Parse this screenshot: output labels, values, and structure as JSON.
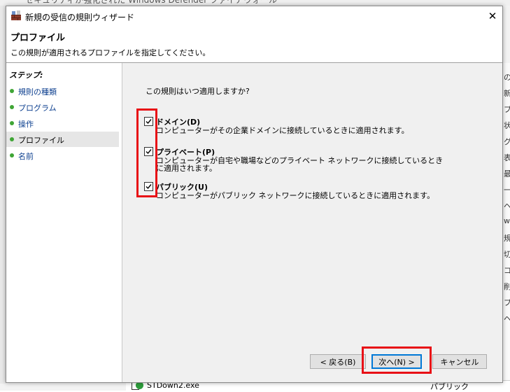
{
  "background_window": {
    "title": "セキュリティが強化された Windows Defender ファイアウォール",
    "right_panel_items": [
      "の",
      "新",
      "プ",
      "状",
      "グ",
      "表",
      "最",
      "一",
      "ヘ",
      "w",
      "規",
      "切",
      "コ",
      "削",
      "プ",
      "ヘ"
    ],
    "table_row": {
      "name": "STDown2.exe",
      "profile": "パブリック"
    }
  },
  "wizard": {
    "title": "新規の受信の規則ウィザード",
    "close_glyph": "✕",
    "header": {
      "title": "プロファイル",
      "subtitle": "この規則が適用されるプロファイルを指定してください。"
    },
    "steps_label": "ステップ:",
    "steps": [
      {
        "label": "規則の種類",
        "active": false
      },
      {
        "label": "プログラム",
        "active": false
      },
      {
        "label": "操作",
        "active": false
      },
      {
        "label": "プロファイル",
        "active": true
      },
      {
        "label": "名前",
        "active": false
      }
    ],
    "question": "この規則はいつ適用しますか?",
    "options": [
      {
        "label": "ドメイン(D)",
        "description": "コンピューターがその企業ドメインに接続しているときに適用されます。",
        "checked": true
      },
      {
        "label": "プライベート(P)",
        "description": "コンピューターが自宅や職場などのプライベート ネットワークに接続しているときに適用されます。",
        "checked": true
      },
      {
        "label": "パブリック(U)",
        "description": "コンピューターがパブリック ネットワークに接続しているときに適用されます。",
        "checked": true
      }
    ],
    "buttons": {
      "back": "< 戻る(B)",
      "next": "次へ(N) >",
      "cancel": "キャンセル"
    }
  },
  "colors": {
    "highlight": "#e81016",
    "step_dot": "#3fa535",
    "step_link": "#0c3f8f",
    "accent": "#0078d7"
  }
}
